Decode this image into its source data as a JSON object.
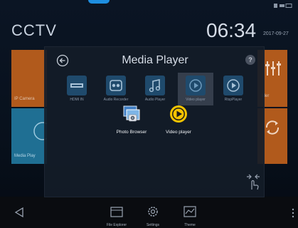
{
  "home": {
    "title": "CCTV",
    "clock": "06:34",
    "date": "2017-09-27",
    "tiles": {
      "ip_camera": "IP Camera",
      "media_player": "Media Play",
      "right_top": "Ider"
    }
  },
  "dock": {
    "items": [
      {
        "label": "File Explorer",
        "icon": "folder-icon"
      },
      {
        "label": "Settings",
        "icon": "gear-icon"
      },
      {
        "label": "Theme",
        "icon": "chart-icon"
      }
    ]
  },
  "modal": {
    "title": "Media Player",
    "help": "?",
    "apps": [
      {
        "label": "HDMI IN",
        "icon": "hdmi-icon"
      },
      {
        "label": "Audio Recorder",
        "icon": "recorder-icon"
      },
      {
        "label": "Audio Player",
        "icon": "music-note-icon"
      },
      {
        "label": "Video player",
        "icon": "play-icon"
      },
      {
        "label": "RtspPlayer",
        "icon": "play-icon"
      }
    ],
    "sub_apps": [
      {
        "label": "Photo Browser",
        "icon": "photo-icon"
      },
      {
        "label": "Video player",
        "icon": "play-circle-icon"
      }
    ]
  },
  "colors": {
    "orange_tile": "#b15a1c",
    "blue_tile": "#1f6f93",
    "accent_yellow": "#f5c400",
    "accent_blue": "#1e8ee0"
  }
}
